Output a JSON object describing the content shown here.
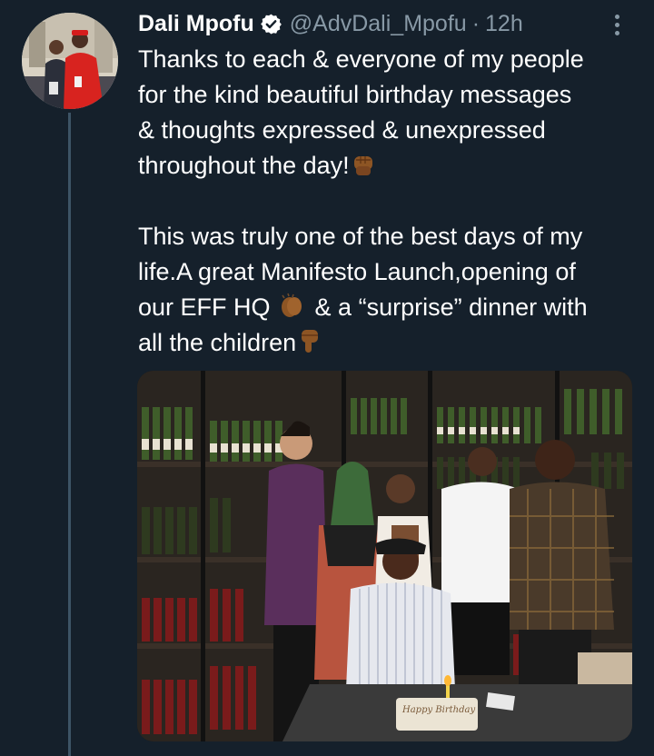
{
  "tweet": {
    "author": {
      "display_name": "Dali Mpofu",
      "handle": "@AdvDali_Mpofu",
      "verified": true,
      "avatar": "profile-photo"
    },
    "separator": "·",
    "time": "12h",
    "more_icon": "more-vertical-icon",
    "lines": {
      "l1": "Thanks to each & everyone of my people",
      "l2": "for the kind beautiful birthday messages",
      "l3": "& thoughts expressed & unexpressed",
      "l4": "throughout the day!",
      "l5": "This was truly one of the best days of my",
      "l6": "life.A great Manifesto Launch,opening of",
      "l7a": "our EFF HQ",
      "l7b": " & a “surprise” dinner with",
      "l8": "all the children"
    },
    "emojis": [
      "raised-fist-dark-skin",
      "clapping-hands-dark-skin",
      "backhand-index-pointing-down-dark-skin"
    ],
    "media": {
      "type": "photo",
      "description_icon": "birthday-dinner-photo",
      "cake_text": "Happy Birthday"
    }
  },
  "colors": {
    "background": "#15202b",
    "primary_text": "#ffffff",
    "secondary_text": "#8899a6",
    "thread_line": "#3d5466",
    "verified_badge": "#ffffff"
  }
}
